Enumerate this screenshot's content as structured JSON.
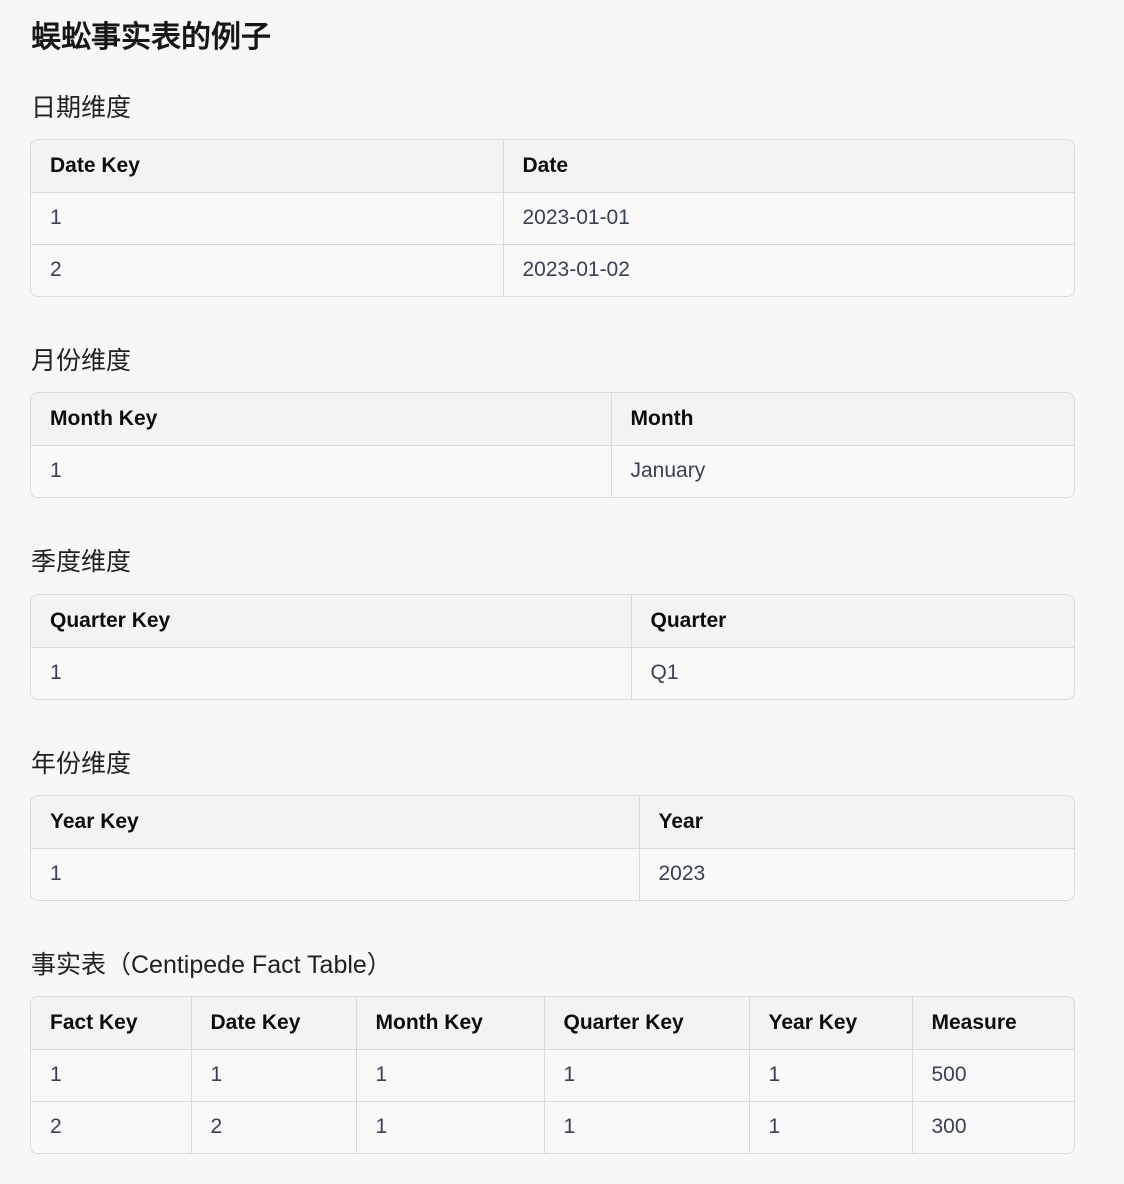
{
  "title": "蜈蚣事实表的例子",
  "sections": [
    {
      "heading": "日期维度",
      "columns": [
        "Date Key",
        "Date"
      ],
      "rows": [
        [
          "1",
          "2023-01-01"
        ],
        [
          "2",
          "2023-01-02"
        ]
      ]
    },
    {
      "heading": "月份维度",
      "columns": [
        "Month Key",
        "Month"
      ],
      "rows": [
        [
          "1",
          "January"
        ]
      ]
    },
    {
      "heading": "季度维度",
      "columns": [
        "Quarter Key",
        "Quarter"
      ],
      "rows": [
        [
          "1",
          "Q1"
        ]
      ]
    },
    {
      "heading": "年份维度",
      "columns": [
        "Year Key",
        "Year"
      ],
      "rows": [
        [
          "1",
          "2023"
        ]
      ]
    },
    {
      "heading": "事实表（Centipede Fact Table）",
      "columns": [
        "Fact Key",
        "Date Key",
        "Month Key",
        "Quarter Key",
        "Year Key",
        "Measure"
      ],
      "rows": [
        [
          "1",
          "1",
          "1",
          "1",
          "1",
          "500"
        ],
        [
          "2",
          "2",
          "1",
          "1",
          "1",
          "300"
        ]
      ]
    }
  ]
}
